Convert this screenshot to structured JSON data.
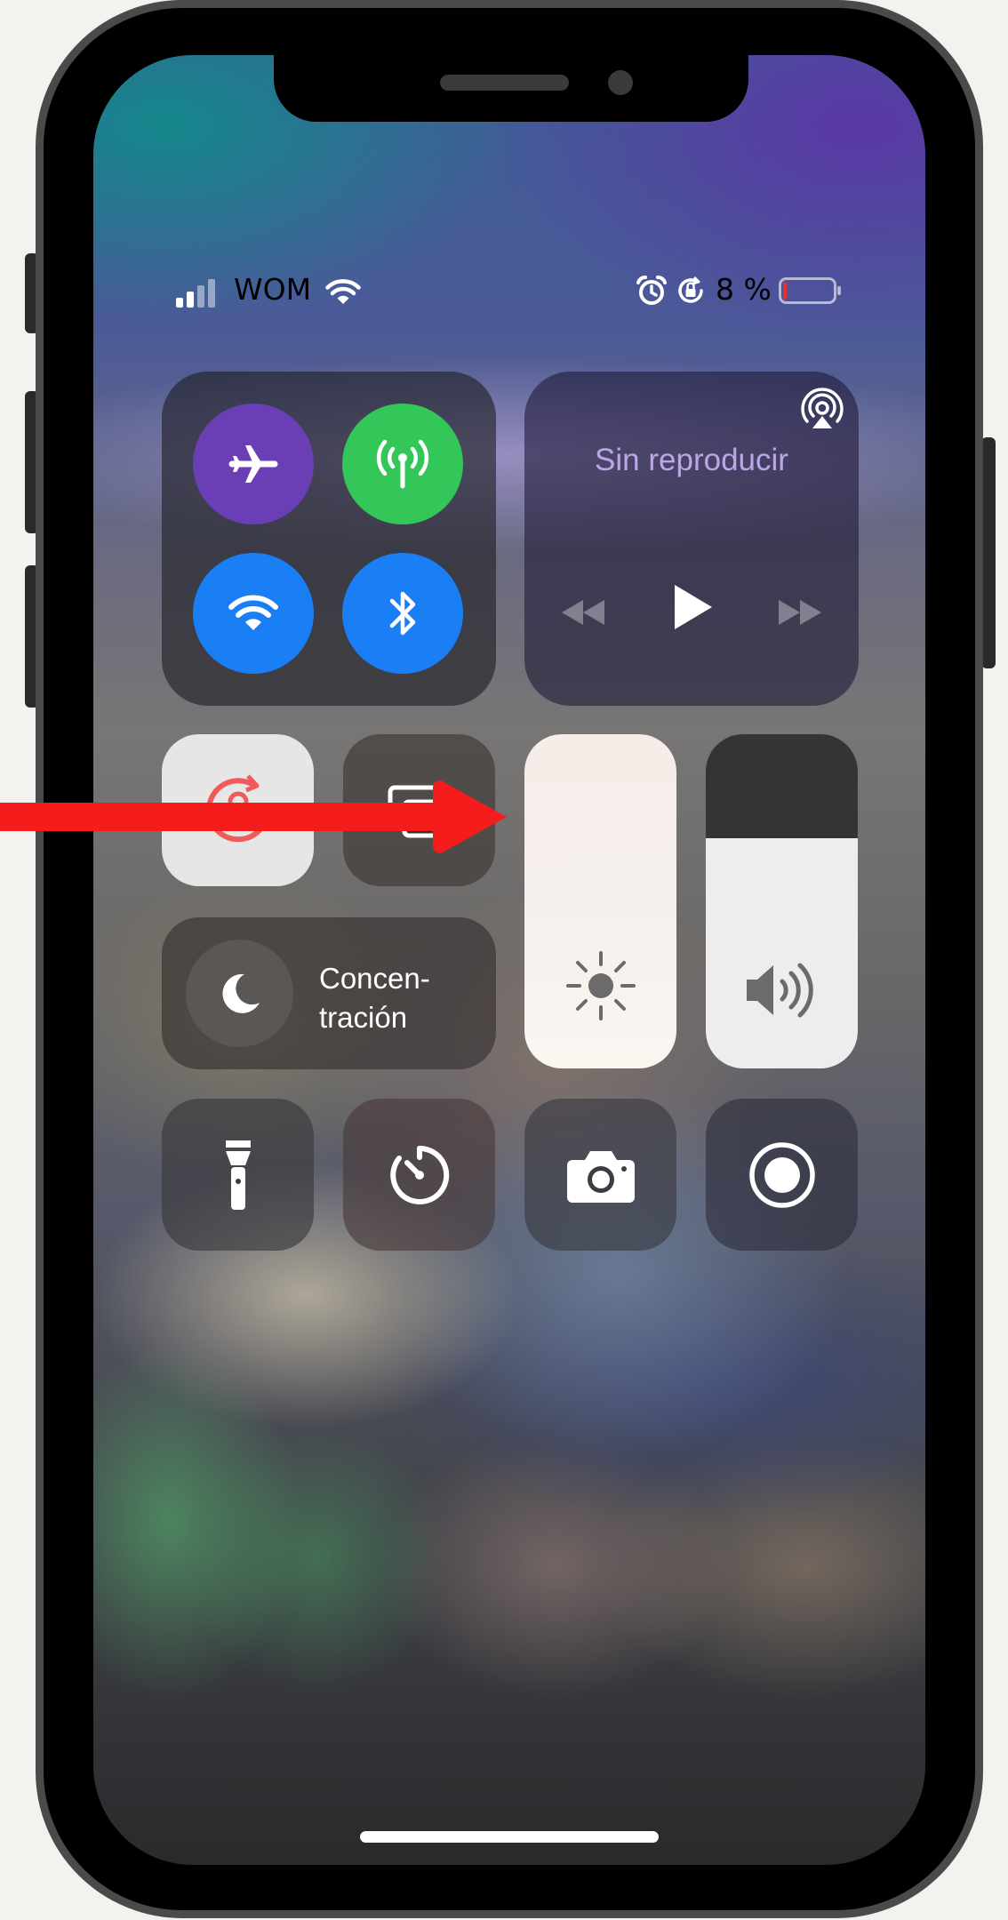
{
  "status_bar": {
    "carrier": "WOM",
    "battery_percent": "8 %",
    "battery_level": 0.08,
    "signal_bars": 2,
    "signal_bars_total": 4
  },
  "media": {
    "title": "Sin reproducir"
  },
  "focus": {
    "label_line1": "Concen-",
    "label_line2": "tración"
  },
  "sliders": {
    "brightness_level": 1.0,
    "volume_level": 0.69
  },
  "colors": {
    "airplane": "#6a3fb5",
    "cellular": "#33c759",
    "wifi": "#1a7ef5",
    "bluetooth": "#1a7ef5",
    "arrow": "#f51c1c",
    "battery_low": "#e53030",
    "orientation_lock": "#f05a5a"
  },
  "icons": {
    "connectivity": [
      "airplane-icon",
      "cellular-antenna-icon",
      "wifi-icon",
      "bluetooth-icon"
    ],
    "media": [
      "airplay-icon",
      "rewind-icon",
      "play-icon",
      "fast-forward-icon"
    ],
    "tiles": [
      "orientation-lock-icon",
      "screen-mirroring-icon",
      "moon-icon",
      "sun-icon",
      "speaker-icon",
      "flashlight-icon",
      "timer-icon",
      "camera-icon",
      "screen-record-icon"
    ]
  }
}
